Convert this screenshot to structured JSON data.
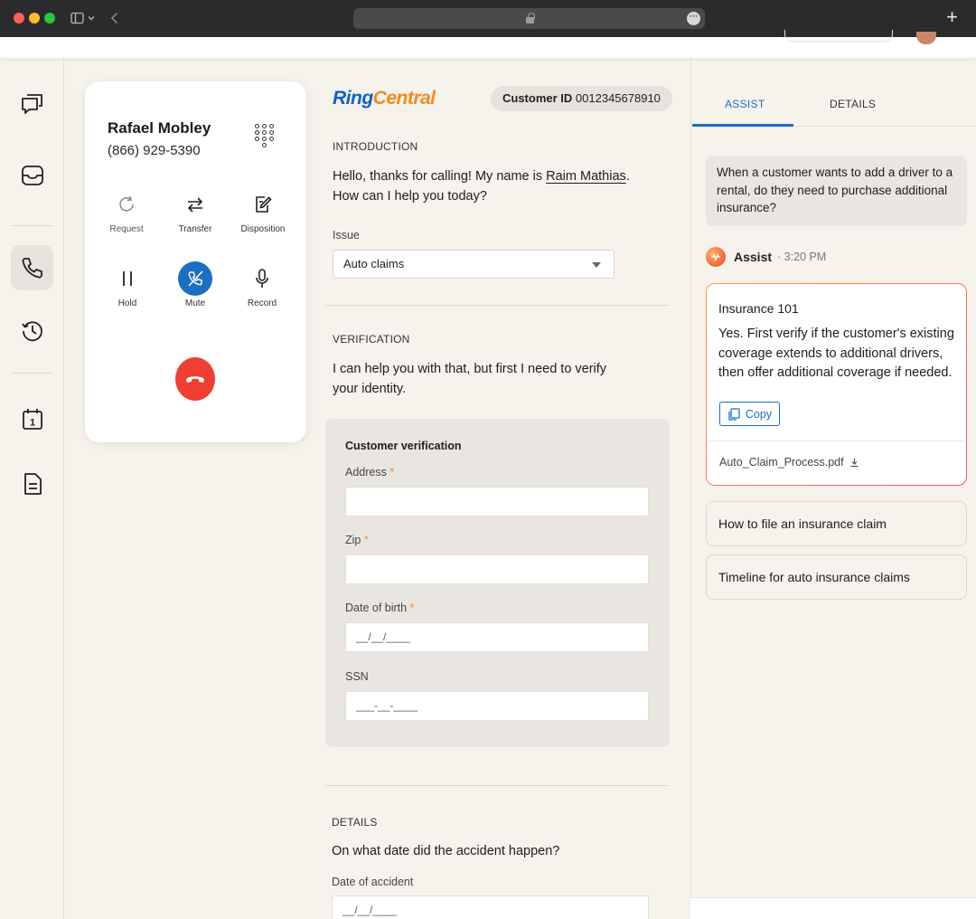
{
  "browser": {
    "colors": {
      "close": "#fe5f57",
      "minimize": "#febc2e",
      "maximize": "#28c840"
    },
    "icons": [
      "sidebar-toggle-icon",
      "chevron-down-icon",
      "back-icon",
      "lock-icon",
      "more-icon",
      "new-tab-icon"
    ],
    "new_tab_label": "+"
  },
  "rail": {
    "icons": [
      "chat-bubbles-icon",
      "inbox-icon",
      "phone-icon",
      "history-icon",
      "calendar-icon",
      "document-icon"
    ],
    "active": "phone-icon",
    "calendar_day": "1"
  },
  "call": {
    "name": "Rafael Mobley",
    "phone": "(866) 929-5390",
    "controls": {
      "request": "Request",
      "transfer": "Transfer",
      "disposition": "Disposition",
      "hold": "Hold",
      "mute": "Mute",
      "record": "Record"
    },
    "mute_active": true,
    "accent": "#1a6fc2",
    "hangup_color": "#ee3f32"
  },
  "script": {
    "logo": {
      "ring": "Ring",
      "central": "Central"
    },
    "customer_id_label": "Customer ID",
    "customer_id": "0012345678910",
    "intro": {
      "heading": "INTRODUCTION",
      "text_before": "Hello, thanks for calling! My name is ",
      "agent_name": "Raim Mathias",
      "text_after": ". How can I help you today?"
    },
    "issue": {
      "label": "Issue",
      "value": "Auto claims"
    },
    "verification": {
      "heading": "VERIFICATION",
      "text": "I can help you with that, but first I need to verify your identity.",
      "box_title": "Customer verification",
      "fields": {
        "address": {
          "label": "Address",
          "required": "*",
          "value": ""
        },
        "zip": {
          "label": "Zip",
          "required": "*",
          "value": ""
        },
        "dob": {
          "label": "Date of birth",
          "required": "*",
          "placeholder": "__/__/____"
        },
        "ssn": {
          "label": "SSN",
          "placeholder": "___-__-____"
        }
      }
    },
    "details": {
      "heading": "DETAILS",
      "question": "On what date did the accident happen?",
      "date_label": "Date of accident",
      "date_placeholder": "__/__/____"
    }
  },
  "assist_panel": {
    "tabs": {
      "assist": "ASSIST",
      "details": "DETAILS"
    },
    "active_tab": "assist",
    "question": "When a customer wants to add a driver to a rental, do they need to purchase additional insurance?",
    "assist_name": "Assist",
    "assist_time": "· 3:20 PM",
    "answer": {
      "title": "Insurance 101",
      "body": "Yes. First verify if the customer's existing coverage extends to additional drivers, then offer additional coverage if needed.",
      "copy_label": "Copy",
      "file": "Auto_Claim_Process.pdf"
    },
    "suggestions": [
      "How to file an insurance claim",
      "Timeline for auto insurance claims"
    ]
  }
}
